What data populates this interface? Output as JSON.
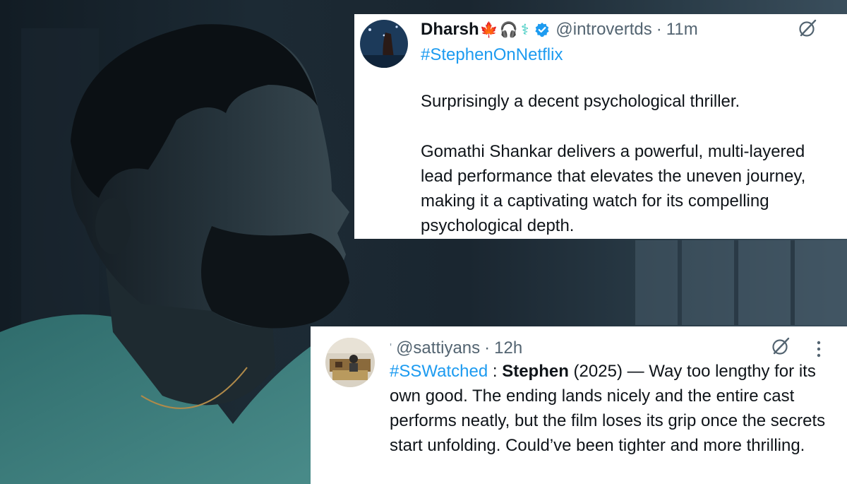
{
  "colors": {
    "accent_link": "#1d9bf0",
    "text_primary": "#0f1419",
    "text_secondary": "#536471",
    "verified_badge": "#1d9bf0"
  },
  "background": {
    "icon": "man-profile-still-icon"
  },
  "tweet_1": {
    "display_name": "Dharsh",
    "name_emojis": [
      "🍁",
      "🎧",
      "⚕"
    ],
    "verified_icon": "verified-badge-icon",
    "handle": "@introvertds",
    "separator": "·",
    "time": "11m",
    "grok_icon": "grok-icon",
    "hashtag": "#StephenOnNetflix",
    "paragraph_1": "Surprisingly a decent psychological thriller.",
    "paragraph_2_lines": [
      "Gomathi Shankar delivers a powerful, multi-layered",
      "lead performance that elevates the uneven journey,",
      "making it a captivating watch for its compelling",
      "psychological depth."
    ]
  },
  "tweet_2": {
    "partial_glyph": "'",
    "handle": "@sattiyans",
    "separator": "·",
    "time": "12h",
    "grok_icon": "grok-icon",
    "more_icon": "more-vertical-icon",
    "hashtag": "#SSWatched",
    "colon": " : ",
    "bold_title": "Stephen",
    "text_rest": " (2025) — Way too lengthy for its own good. The ending lands nicely and the entire cast performs neatly, but the film loses its grip once the secrets start unfolding. Could’ve been tighter and more thrilling."
  }
}
